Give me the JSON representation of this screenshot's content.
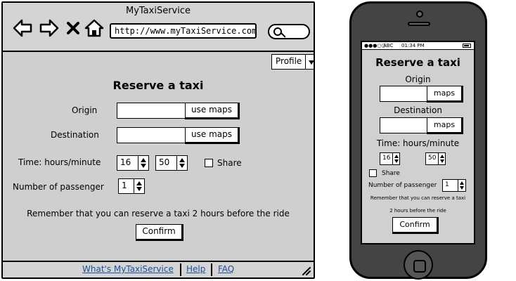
{
  "browser": {
    "window_title": "MyTaxiService",
    "url": "http://www.myTaxiService.com/",
    "nav_icons": [
      "back-arrow-icon",
      "forward-arrow-icon",
      "close-icon",
      "home-icon"
    ],
    "profile_label": "Profile"
  },
  "form": {
    "title": "Reserve a taxi",
    "origin_label": "Origin",
    "origin_value": "",
    "origin_maps_button": "use maps",
    "destination_label": "Destination",
    "destination_value": "",
    "destination_maps_button": "use maps",
    "time_label": "Time: hours/minute",
    "hours_value": "16",
    "minutes_value": "50",
    "share_label": "Share",
    "share_checked": false,
    "passenger_label": "Number of passenger",
    "passenger_value": "1",
    "reminder": "Remember that you can reserve a taxi 2 hours before the ride",
    "confirm_label": "Confirm"
  },
  "footer": {
    "links": [
      "What's MyTaxiService",
      "Help",
      "FAQ"
    ]
  },
  "phone": {
    "status": {
      "carrier": "ABC",
      "time": "01:34 PM"
    },
    "title": "Reserve a taxi",
    "origin_label": "Origin",
    "origin_maps_button": "maps",
    "destination_label": "Destination",
    "destination_maps_button": "maps",
    "time_label": "Time: hours/minute",
    "hours_value": "16",
    "minutes_value": "50",
    "share_label": "Share",
    "passenger_label": "Number of passenger",
    "passenger_value": "1",
    "reminder_line1": "Remember that you can reserve a taxi",
    "reminder_line2": "2 hours before the ride",
    "confirm_label": "Confirm"
  }
}
